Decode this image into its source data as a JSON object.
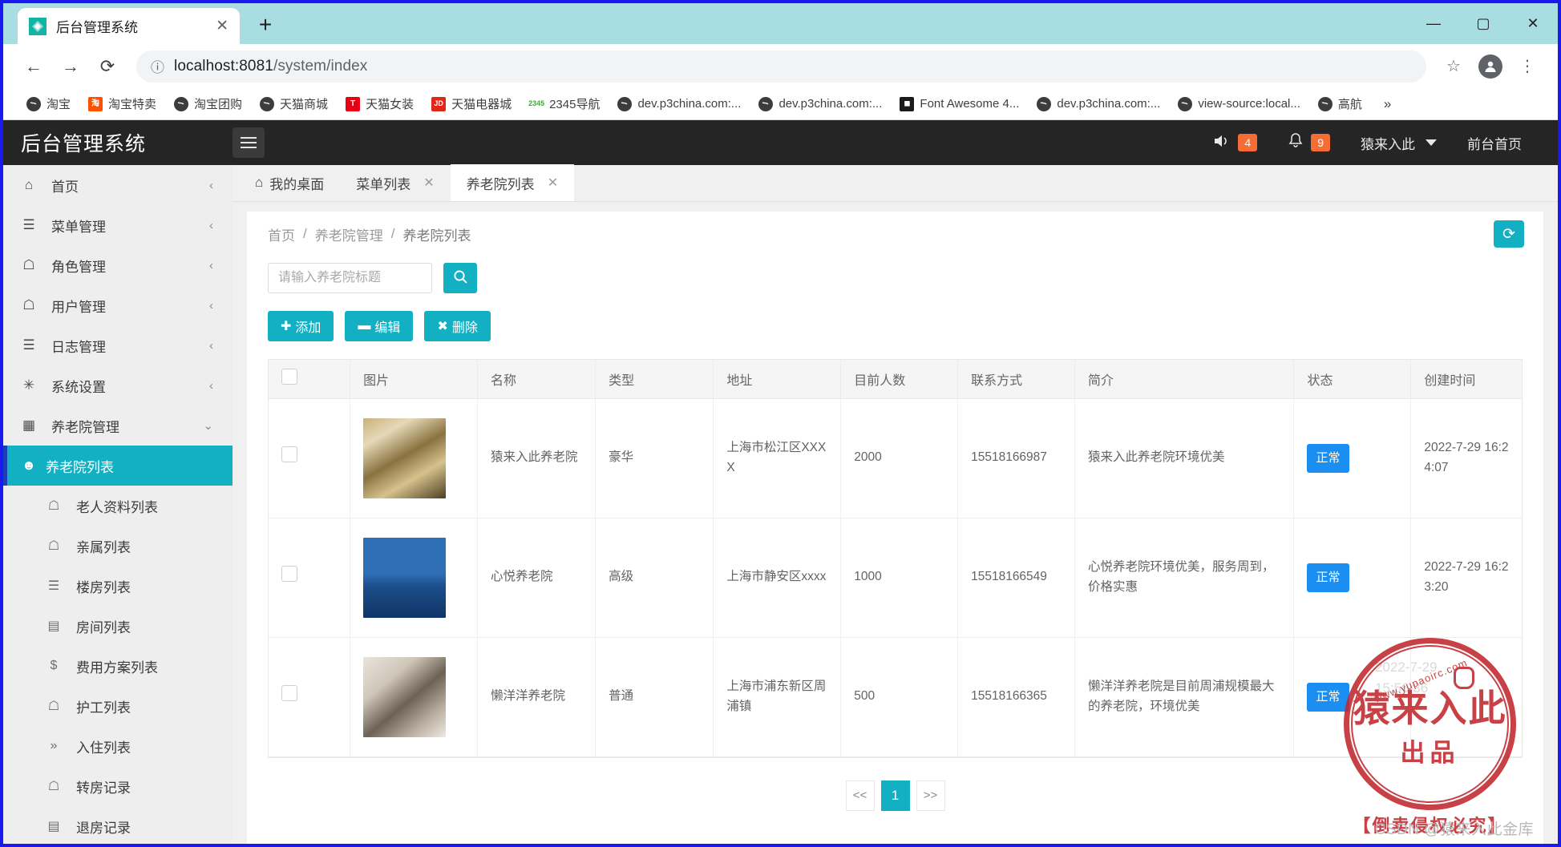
{
  "browser": {
    "tab_title": "后台管理系统",
    "tab_close": "✕",
    "new_tab": "+",
    "url_host": "localhost:8081",
    "url_path": "/system/index",
    "window_minimize": "—",
    "window_maximize": "▢",
    "window_close": "✕",
    "bookmarks": [
      {
        "label": "淘宝",
        "icon": "globe-icon",
        "style": "ic-globe",
        "glyph": ""
      },
      {
        "label": "淘宝特卖",
        "icon": "taobao-icon",
        "style": "ic-tb",
        "glyph": "淘"
      },
      {
        "label": "淘宝团购",
        "icon": "globe-icon",
        "style": "ic-globe",
        "glyph": ""
      },
      {
        "label": "天猫商城",
        "icon": "globe-icon",
        "style": "ic-globe",
        "glyph": ""
      },
      {
        "label": "天猫女装",
        "icon": "tmall-icon",
        "style": "ic-tm",
        "glyph": "T"
      },
      {
        "label": "天猫电器城",
        "icon": "jd-icon",
        "style": "ic-jd",
        "glyph": "JD"
      },
      {
        "label": "2345导航",
        "icon": "nav2345-icon",
        "style": "ic-2345",
        "glyph": "2345"
      },
      {
        "label": "dev.p3china.com:...",
        "icon": "globe-icon",
        "style": "ic-globe",
        "glyph": ""
      },
      {
        "label": "dev.p3china.com:...",
        "icon": "globe-icon",
        "style": "ic-globe",
        "glyph": ""
      },
      {
        "label": "Font Awesome 4...",
        "icon": "font-awesome-icon",
        "style": "ic-fa",
        "glyph": "◼"
      },
      {
        "label": "dev.p3china.com:...",
        "icon": "globe-icon",
        "style": "ic-globe",
        "glyph": ""
      },
      {
        "label": "view-source:local...",
        "icon": "globe-icon",
        "style": "ic-globe",
        "glyph": ""
      },
      {
        "label": "高航",
        "icon": "globe-icon",
        "style": "ic-globe",
        "glyph": ""
      }
    ],
    "bookmarks_overflow": "»"
  },
  "header": {
    "brand": "后台管理系统",
    "sound_count": "4",
    "bell_count": "9",
    "user": "猿来入此",
    "front_page": "前台首页"
  },
  "sidebar": {
    "items": [
      {
        "label": "首页",
        "icon": "home-icon",
        "glyph": "⌂",
        "arrow": "‹"
      },
      {
        "label": "菜单管理",
        "icon": "menu-icon",
        "glyph": "☰",
        "arrow": "‹"
      },
      {
        "label": "角色管理",
        "icon": "user-icon",
        "glyph": "☖",
        "arrow": "‹"
      },
      {
        "label": "用户管理",
        "icon": "user-icon",
        "glyph": "☖",
        "arrow": "‹"
      },
      {
        "label": "日志管理",
        "icon": "list-icon",
        "glyph": "☰",
        "arrow": "‹"
      },
      {
        "label": "系统设置",
        "icon": "gear-icon",
        "glyph": "✳",
        "arrow": "‹"
      },
      {
        "label": "养老院管理",
        "icon": "grid-icon",
        "glyph": "▦",
        "arrow": "⌄"
      }
    ],
    "sub_items": [
      {
        "label": "养老院列表",
        "icon": "building-icon",
        "glyph": "☻",
        "active": true
      },
      {
        "label": "老人资料列表",
        "icon": "user-icon",
        "glyph": "☖",
        "active": false
      },
      {
        "label": "亲属列表",
        "icon": "user-icon",
        "glyph": "☖",
        "active": false
      },
      {
        "label": "楼房列表",
        "icon": "layers-icon",
        "glyph": "☰",
        "active": false
      },
      {
        "label": "房间列表",
        "icon": "room-icon",
        "glyph": "▤",
        "active": false
      },
      {
        "label": "费用方案列表",
        "icon": "dollar-icon",
        "glyph": "$",
        "active": false
      },
      {
        "label": "护工列表",
        "icon": "user-icon",
        "glyph": "☖",
        "active": false
      },
      {
        "label": "入住列表",
        "icon": "double-arrow-icon",
        "glyph": "»",
        "active": false
      },
      {
        "label": "转房记录",
        "icon": "user-icon",
        "glyph": "☖",
        "active": false
      },
      {
        "label": "退房记录",
        "icon": "room-icon",
        "glyph": "▤",
        "active": false
      }
    ]
  },
  "page_tabs": [
    {
      "label": "我的桌面",
      "closable": false,
      "active": false,
      "icon": "home-icon",
      "glyph": "⌂"
    },
    {
      "label": "菜单列表",
      "closable": true,
      "active": false
    },
    {
      "label": "养老院列表",
      "closable": true,
      "active": true
    }
  ],
  "tab_close_glyph": "✕",
  "breadcrumb": {
    "items": [
      "首页",
      "养老院管理",
      "养老院列表"
    ],
    "separator": "/"
  },
  "refresh_button": "⟳",
  "search": {
    "value": "",
    "placeholder": "请输入养老院标题",
    "button_icon": "search-icon"
  },
  "action_buttons": [
    {
      "label": "添加",
      "glyph": "✚",
      "name": "add-button"
    },
    {
      "label": "编辑",
      "glyph": "▬",
      "name": "edit-button"
    },
    {
      "label": "删除",
      "glyph": "✖",
      "name": "delete-button"
    }
  ],
  "table": {
    "columns": [
      "",
      "图片",
      "名称",
      "类型",
      "地址",
      "目前人数",
      "联系方式",
      "简介",
      "状态",
      "创建时间"
    ],
    "rows": [
      {
        "name": "猿来入此养老院",
        "type": "豪华",
        "address": "上海市松江区XXXX",
        "population": "2000",
        "phone": "15518166987",
        "intro": "猿来入此养老院环境优美",
        "status": "正常",
        "created": "2022-7-29 16:24:07",
        "image_alt": "coins-money-photo"
      },
      {
        "name": "心悦养老院",
        "type": "高级",
        "address": "上海市静安区xxxx",
        "population": "1000",
        "phone": "15518166549",
        "intro": "心悦养老院环境优美，服务周到，价格实惠",
        "status": "正常",
        "created": "2022-7-29 16:23:20",
        "image_alt": "hands-house-photo"
      },
      {
        "name": "懒洋洋养老院",
        "type": "普通",
        "address": "上海市浦东新区周浦镇",
        "population": "500",
        "phone": "15518166365",
        "intro": "懒洋洋养老院是目前周浦规模最大的养老院，环境优美",
        "status": "正常",
        "created": "",
        "image_alt": "hands-holding-photo"
      }
    ]
  },
  "pagination": {
    "prev": "<<",
    "pages": [
      "1"
    ],
    "next": ">>",
    "current": "1"
  },
  "watermark": {
    "stamp_line1": "猿来入此",
    "stamp_line2": "出品",
    "stamp_url": "www.yupaoirc.com",
    "stamp_bottom": "【倒卖侵权必究】",
    "csdn": "CSDN @猿来入此金库",
    "hidden_time": "2022-7-29 15:56:36"
  },
  "colors": {
    "accent": "#13b0c4",
    "header_bg": "#252525",
    "badge": "#f56c35",
    "status": "#1b8ef2",
    "sidebar_active_border": "#1a3fb8",
    "browser_border": "#1a1af0",
    "tabstrip": "#a8dde2",
    "stamp_red": "#c0272d"
  }
}
